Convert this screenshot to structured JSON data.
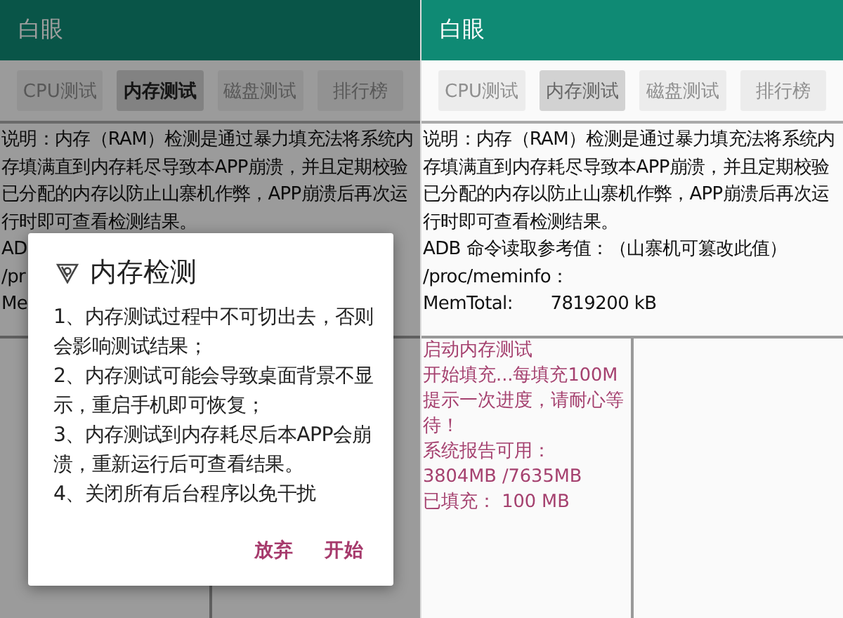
{
  "screens": [
    {
      "title": "白眼",
      "tabs": [
        {
          "label": "CPU测试",
          "selected": false,
          "disabled": true
        },
        {
          "label": "内存测试",
          "selected": true,
          "disabled": false
        },
        {
          "label": "磁盘测试",
          "selected": false,
          "disabled": true
        },
        {
          "label": "排行榜",
          "selected": false,
          "disabled": true
        }
      ],
      "description": "说明：内存（RAM）检测是通过暴力填充法将系统内存填满直到内存耗尽导致本APP崩溃，并且定期校验已分配的内存以防止山寨机作弊，APP崩溃后再次运行时即可查看检测结果。",
      "info_lines": [
        "AD",
        "/pr",
        "Me"
      ],
      "dialog": {
        "title": "内存检测",
        "items": [
          "1、内存测试过程中不可切出去，否则会影响测试结果；",
          "2、内存测试可能会导致桌面背景不显示，重启手机即可恢复；",
          "3、内存测试到内存耗尽后本APP会崩溃，重新运行后可查看结果。",
          "4、关闭所有后台程序以免干扰"
        ],
        "buttons": [
          "放弃",
          "开始"
        ]
      }
    },
    {
      "title": "白眼",
      "tabs": [
        {
          "label": "CPU测试",
          "selected": false,
          "disabled": true
        },
        {
          "label": "内存测试",
          "selected": true,
          "disabled": true
        },
        {
          "label": "磁盘测试",
          "selected": false,
          "disabled": true
        },
        {
          "label": "排行榜",
          "selected": false,
          "disabled": true
        }
      ],
      "description": "说明：内存（RAM）检测是通过暴力填充法将系统内存填满直到内存耗尽导致本APP崩溃，并且定期校验已分配的内存以防止山寨机作弊，APP崩溃后再次运行时即可查看检测结果。",
      "info_lines": [
        "ADB 命令读取参考值：（山寨机可篡改此值）",
        "/proc/meminfo：",
        "MemTotal:       7819200 kB"
      ],
      "log_lines": [
        "启动内存测试",
        "开始填充...每填充100M提示一次进度，请耐心等待！",
        "系统报告可用：",
        "3804MB /7635MB",
        "已填充：  100 MB"
      ]
    }
  ]
}
